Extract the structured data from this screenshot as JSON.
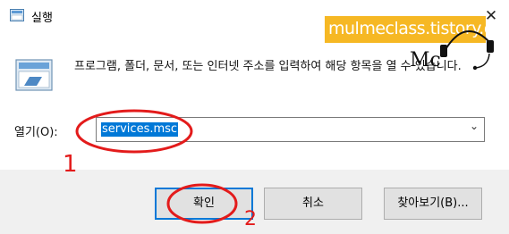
{
  "window": {
    "title": "실행",
    "close_glyph": "✕"
  },
  "watermark": {
    "text": "mulmeclass.tistory.com"
  },
  "description": "프로그램, 폴더, 문서, 또는 인터넷 주소를 입력하여 해당 항목을 열 수 있습니다.",
  "open_field": {
    "label": "열기(O):",
    "value": "services.msc",
    "arrow": "⌄"
  },
  "buttons": {
    "ok": "확인",
    "cancel": "취소",
    "browse": "찾아보기(B)..."
  },
  "annotations": {
    "step1": "1",
    "step2": "2",
    "logo_text": "Mc"
  },
  "colors": {
    "selection": "#0078d7",
    "watermark_bg": "#f6b824",
    "annotation": "#e31b1b",
    "footer_bg": "#f0f0f0"
  }
}
